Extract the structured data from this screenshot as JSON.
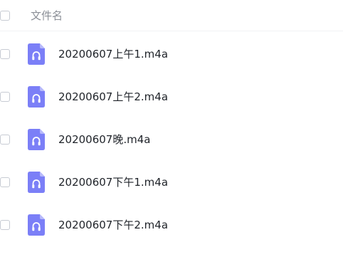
{
  "header": {
    "column_label": "文件名"
  },
  "files": [
    {
      "name": "20200607上午1.m4a",
      "icon": "audio-file-icon"
    },
    {
      "name": "20200607上午2.m4a",
      "icon": "audio-file-icon"
    },
    {
      "name": "20200607晚.m4a",
      "icon": "audio-file-icon"
    },
    {
      "name": "20200607下午1.m4a",
      "icon": "audio-file-icon"
    },
    {
      "name": "20200607下午2.m4a",
      "icon": "audio-file-icon"
    }
  ],
  "colors": {
    "icon_bg": "#7b7ff7",
    "icon_fold": "#b7b9fb",
    "text": "#1f2329",
    "header_text": "#8b8f97"
  }
}
